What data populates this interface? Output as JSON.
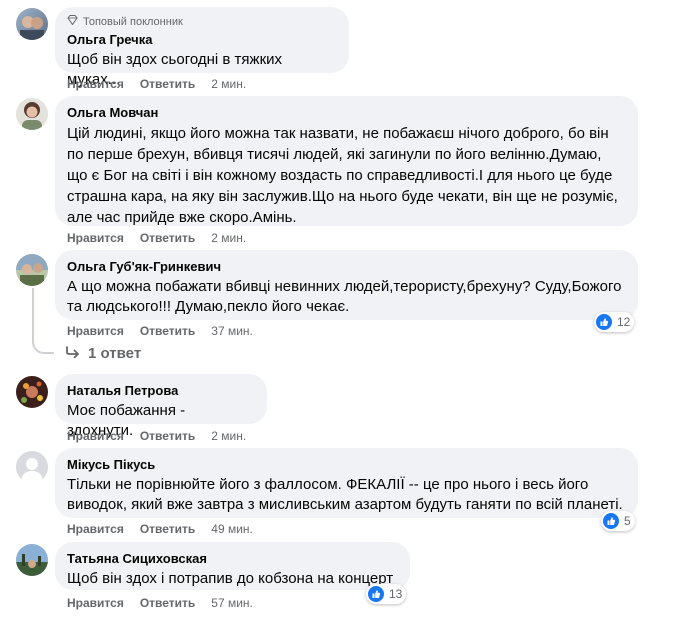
{
  "actions": {
    "like": "Нравится",
    "reply": "Ответить"
  },
  "comments": [
    {
      "badge": "Топовый поклонник",
      "name": "Ольга Гречка",
      "text": "Щоб він здох сьогодні в тяжких муках...",
      "time": "2 мин."
    },
    {
      "name": "Ольга Мовчан",
      "text": "Цій людині, якщо його можна так назвати, не побажаєш нічого доброго, бо він по перше брехун, вбивця тисячі людей, які загинули по його велінню.Думаю, що є Бог на світі і він кожному воздасть по справедливості.І для нього це буде страшна кара, на яку він заслужив.Що на нього буде чекати, він ще не розуміє, але час прийде вже скоро.Амінь.",
      "time": "2 мин."
    },
    {
      "name": "Ольга Губ'як-Гринкевич",
      "text": "А що можна побажати вбивці невинних людей,терористу,брехуну? Суду,Божого та людського!!! Думаю,пекло його чекає.",
      "time": "37 мин.",
      "reactions": "12",
      "replies": "1 ответ"
    },
    {
      "name": "Наталья Петрова",
      "text": "Моє побажання - здохнути.",
      "time": "2 мин."
    },
    {
      "name": "Мікусь Пікусь",
      "text": "Тільки не порівнюйте його з фаллосом. ФЕКАЛІЇ -- це про нього і весь його виводок, який вже завтра з мисливським азартом будуть ганяти по всій планеті.",
      "time": "49 мин.",
      "reactions": "5"
    },
    {
      "name": "Татьяна Сициховская",
      "text": "Щоб він здох і потрапив до кобзона на концерт",
      "time": "57 мин.",
      "reactions": "13"
    }
  ],
  "colors": {
    "accent": "#1877f2",
    "bubble": "#f0f2f5",
    "muted": "#65676b"
  }
}
